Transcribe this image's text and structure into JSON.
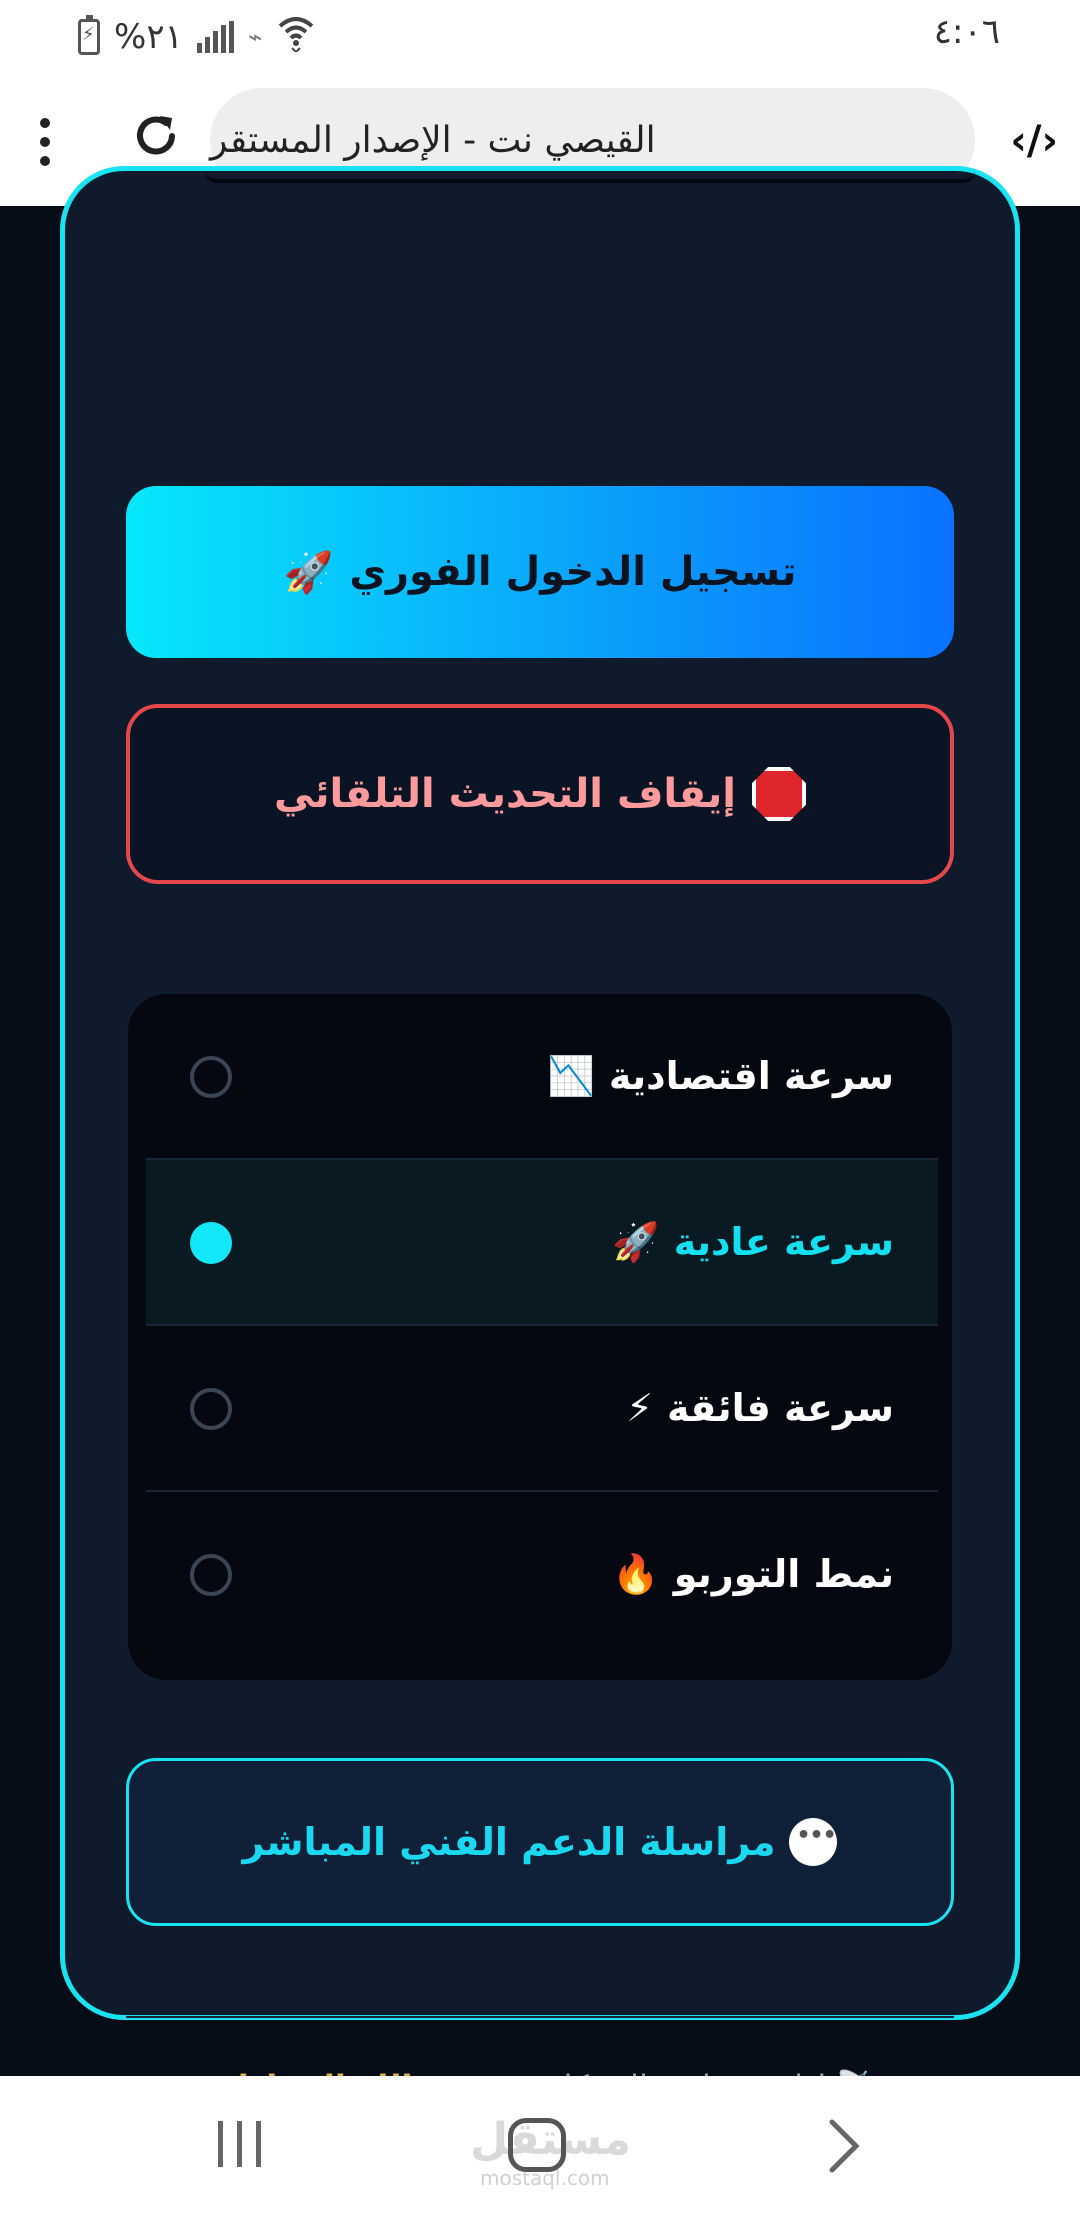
{
  "status_bar": {
    "time": "٤:٠٦",
    "battery_percent": "%٢١"
  },
  "browser": {
    "url_title": "القيصي نت - الإصدار المستقر",
    "site_icon": "‹/›"
  },
  "main": {
    "login_button": "تسجيل الدخول الفوري",
    "login_icon": "🚀",
    "stop_button": "إيقاف التحديث التلقائي",
    "speed_options": [
      {
        "label": "سرعة اقتصادية",
        "icon": "📉",
        "selected": false
      },
      {
        "label": "سرعة عادية",
        "icon": "🚀",
        "selected": true
      },
      {
        "label": "سرعة فائقة",
        "icon": "⚡",
        "selected": false
      },
      {
        "label": "نمط التوربو",
        "icon": "🔥",
        "selected": false
      }
    ],
    "support_button": "مراسلة الدعم الفني المباشر",
    "footer_prefix": "إدارة وتطوير الشبكات:",
    "footer_author": "م. عبدالله الحماطي",
    "footer_icon": "📡"
  },
  "watermark": {
    "text": "مستقل",
    "sub": "mostaql.com"
  },
  "colors": {
    "accent": "#19e3f0",
    "danger": "#e6474a",
    "author": "#e3b048",
    "background": "#070d17"
  }
}
